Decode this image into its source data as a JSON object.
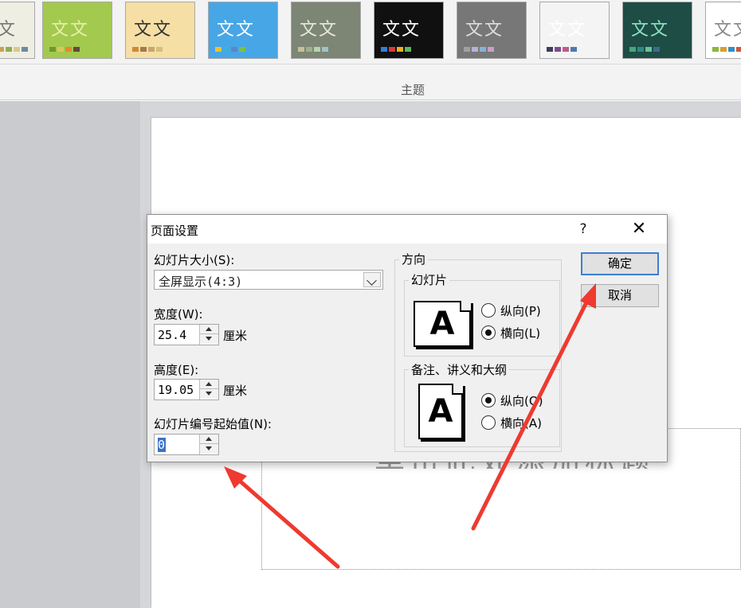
{
  "ribbon": {
    "theme_glyph": "文文",
    "theme_glyph_partial": "文",
    "group_label": "主题",
    "themes": [
      {
        "bg": "#eeeee2",
        "fg": "#777777",
        "swatches": [
          "#c7a15a",
          "#8cae4e",
          "#d9c98c",
          "#6d8aa1"
        ]
      },
      {
        "bg": "#a3c94f",
        "fg": "#e5f1a8",
        "swatches": [
          "#6c9a2e",
          "#d9c75c",
          "#e28a2e",
          "#5e4b3a"
        ]
      },
      {
        "bg": "#f6dfa5",
        "fg": "#333333",
        "swatches": [
          "#d08a36",
          "#a27a4e",
          "#c9a56b",
          "#d2c07a"
        ]
      },
      {
        "bg": "#47a6e6",
        "fg": "#ffffff",
        "swatches": [
          "#f0c030",
          "#3bb0d8",
          "#5e86c8",
          "#7ac043"
        ]
      },
      {
        "bg": "#7d8574",
        "fg": "#e8e8d8",
        "swatches": [
          "#c6c09a",
          "#9cb08a",
          "#b7d2b0",
          "#a0c2c8"
        ]
      },
      {
        "bg": "#101010",
        "fg": "#ffffff",
        "swatches": [
          "#2e7fd6",
          "#d53b3b",
          "#e8b21e",
          "#5cb85c"
        ]
      },
      {
        "bg": "#777777",
        "fg": "#dddddd",
        "swatches": [
          "#a0a0a0",
          "#b6b2d8",
          "#8ab0d8",
          "#c8a0c8"
        ]
      },
      {
        "bg": "#f4f4f4",
        "fg": "#ffffff",
        "swatches": [
          "#3d3d5c",
          "#7d4d8a",
          "#c05a8a",
          "#4a7ab0"
        ]
      },
      {
        "bg": "#1d4d44",
        "fg": "#8ee0c0",
        "swatches": [
          "#49a57e",
          "#2e8a86",
          "#68c29a",
          "#3a6d8c"
        ]
      },
      {
        "bg": "#ffffff",
        "fg": "#888888",
        "swatches": [
          "#8ab83a",
          "#d8a02e",
          "#2e90c8",
          "#c85a3a"
        ]
      }
    ]
  },
  "slide": {
    "title_fragment": "单击此处添加标题"
  },
  "dialog": {
    "title": "页面设置",
    "help": "?",
    "close": "✕",
    "size_label": "幻灯片大小(S):",
    "size_value": "全屏显示(4:3)",
    "width_label": "宽度(W):",
    "width_value": "25.4",
    "width_unit": "厘米",
    "height_label": "高度(E):",
    "height_value": "19.05",
    "height_unit": "厘米",
    "start_label": "幻灯片编号起始值(N):",
    "start_value": "0",
    "orientation_group": "方向",
    "slides_group": "幻灯片",
    "notes_group": "备注、讲义和大纲",
    "portrait": "纵向(P)",
    "landscape": "横向(L)",
    "notes_portrait": "纵向(O)",
    "notes_landscape": "横向(A)",
    "ok": "确定",
    "cancel": "取消",
    "page_letter": "A"
  },
  "colors": {
    "arrow": "#ee3a30",
    "default_button_border": "#3c7fd4"
  }
}
